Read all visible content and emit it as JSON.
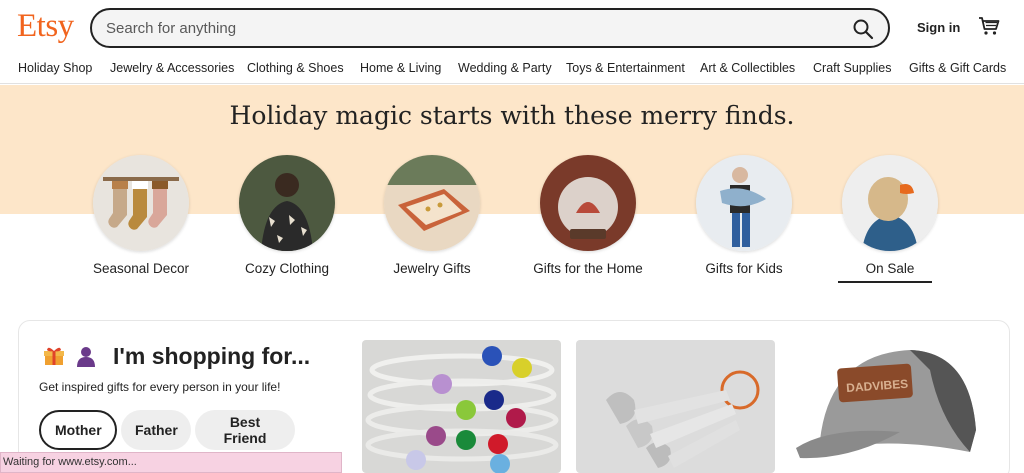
{
  "header": {
    "logo": "Etsy",
    "search_placeholder": "Search for anything",
    "signin_label": "Sign in"
  },
  "nav": {
    "items": [
      "Holiday Shop",
      "Jewelry & Accessories",
      "Clothing & Shoes",
      "Home & Living",
      "Wedding & Party",
      "Toys & Entertainment",
      "Art & Collectibles",
      "Craft Supplies",
      "Gifts & Gift Cards"
    ]
  },
  "hero": {
    "title": "Holiday magic starts with these merry finds.",
    "categories": [
      "Seasonal Decor",
      "Cozy Clothing",
      "Jewelry Gifts",
      "Gifts for the Home",
      "Gifts for Kids",
      "On Sale"
    ]
  },
  "shopping": {
    "title": "I'm shopping for...",
    "subtitle": "Get inspired gifts for every person in your life!",
    "chips": [
      "Mother",
      "Father",
      "Best Friend"
    ],
    "active_chip": "Mother"
  },
  "status_bar": "Waiting for www.etsy.com...",
  "colors": {
    "brand": "#f1641e",
    "hero_band": "#fde6c9"
  }
}
